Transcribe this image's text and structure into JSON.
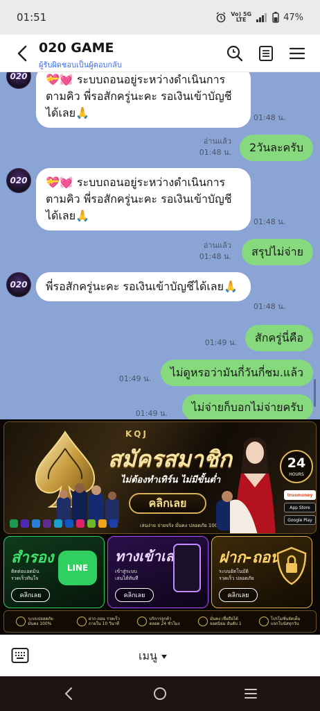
{
  "status": {
    "time": "01:51",
    "net_top": "Vo) 5G",
    "net_bottom": "LTE",
    "battery": "47%"
  },
  "header": {
    "title": "020 GAME",
    "subtitle": "ผู้รับผิดชอบเป็นผู้ตอบกลับ"
  },
  "avatar_label": "020",
  "messages": [
    {
      "side": "in",
      "text": "💝💓 ระบบถอนอยู่ระหว่างดำเนินการตามคิว พี่รอสักครู่นะคะ รอเงินเข้าบัญชีได้เลย🙏",
      "time": "01:48 น."
    },
    {
      "side": "out",
      "text": "2วันละครับ",
      "read": "อ่านแล้ว",
      "time": "01:48 น."
    },
    {
      "side": "in",
      "text": "💝💓 ระบบถอนอยู่ระหว่างดำเนินการตามคิว พี่รอสักครู่นะคะ รอเงินเข้าบัญชีได้เลย🙏",
      "time": "01:48 น."
    },
    {
      "side": "out",
      "text": "สรุปไม่จ่าย",
      "read": "อ่านแล้ว",
      "time": "01:48 น."
    },
    {
      "side": "in",
      "text": "พี่รอสักครู่นะคะ รอเงินเข้าบัญชีได้เลย🙏",
      "time": "01:48 น."
    },
    {
      "side": "out",
      "text": "สักครู่นี่คือ",
      "time": "01:49 น."
    },
    {
      "side": "out",
      "text": "ไม่ดูหรอว่ามันกี่วันกี่ชม.แล้ว",
      "time": "01:49 น."
    },
    {
      "side": "out",
      "text": "ไม่จ่ายก็บอกไม่จ่ายครับ",
      "time": "01:49 น."
    }
  ],
  "banner": {
    "brand": "KQJ",
    "title": "สมัครสมาชิก",
    "subtitle": "ไม่ต้องทำเทิร์น ไม่มีขั้นต่ำ",
    "cta": "คลิกเลย",
    "small_note": "เล่นง่าย จ่ายจริง มั่นคง ปลอดภัย 100%",
    "badge_num": "24",
    "badge_text": "HOURS",
    "truemoney": "truemoney",
    "app_store": "App Store",
    "google_play": "Google Play",
    "cards": [
      {
        "title": "สำรอง",
        "sub": "ติดต่อแอดมิน",
        "sub2": "รวดเร็วทันใจ",
        "btn": "คลิกเลย",
        "logo": "LINE",
        "color": "#2fd05f"
      },
      {
        "title": "ทางเข้าเล่น",
        "sub": "เข้าสู่ระบบ",
        "sub2": "เล่นได้ทันที",
        "btn": "คลิกเลย",
        "color": "#d07cff"
      },
      {
        "title": "ฝาก-ถอน",
        "sub": "ระบบอัตโนมัติ",
        "sub2": "รวดเร็ว ปลอดภัย",
        "btn": "คลิกเลย",
        "color": "#ffd36b"
      }
    ],
    "features": [
      "ระบบปลอดภัย มั่นคง 100%",
      "ฝาก-ถอน รวดเร็ว ภายใน 10 วินาที",
      "บริการลูกค้า ตลอด 24 ชั่วโมง",
      "มั่นคง เชื่อถือได้ ยอดนิยม อันดับ 1",
      "โปรโมชั่นจัดเต็ม แจกโบนัสทุกวัน"
    ]
  },
  "bottom": {
    "menu": "เมนู"
  }
}
